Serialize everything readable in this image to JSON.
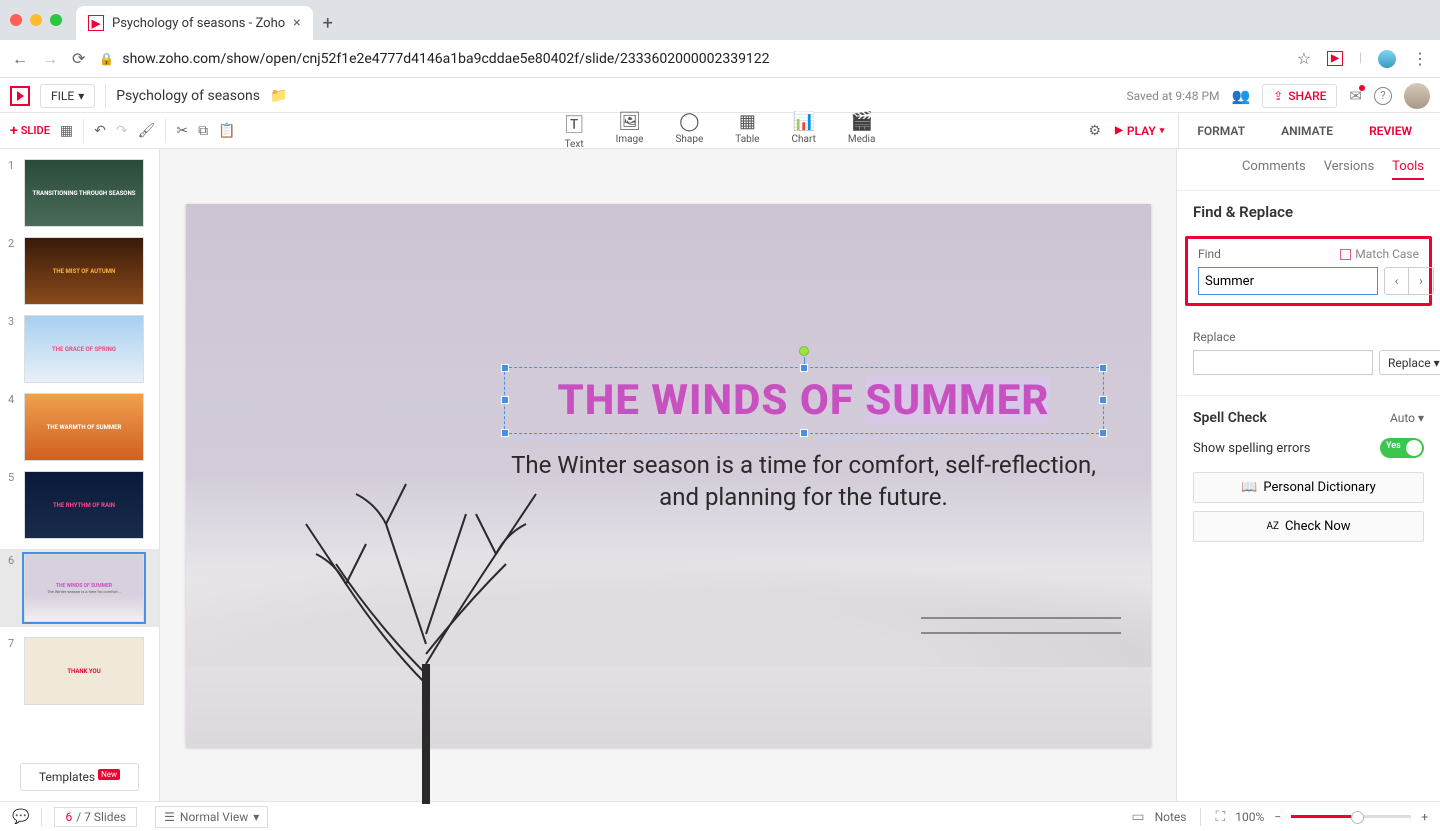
{
  "browser": {
    "tab_title": "Psychology of seasons - Zoho",
    "url": "show.zoho.com/show/open/cnj52f1e2e4777d4146a1ba9cddae5e80402f/slide/2333602000002339122"
  },
  "header": {
    "file_menu": "FILE",
    "doc_title": "Psychology of seasons",
    "saved_text": "Saved at 9:48 PM",
    "share_label": "SHARE"
  },
  "toolbar": {
    "slide_label": "SLIDE",
    "tools": {
      "text": "Text",
      "image": "Image",
      "shape": "Shape",
      "table": "Table",
      "chart": "Chart",
      "media": "Media"
    },
    "play_label": "PLAY",
    "modes": {
      "format": "FORMAT",
      "animate": "ANIMATE",
      "review": "REVIEW"
    }
  },
  "thumbnails": [
    {
      "n": "1",
      "title": "TRANSITIONING THROUGH SEASONS"
    },
    {
      "n": "2",
      "title": "THE MIST OF AUTUMN"
    },
    {
      "n": "3",
      "title": "THE GRACE OF SPRING"
    },
    {
      "n": "4",
      "title": "THE WARMTH OF SUMMER"
    },
    {
      "n": "5",
      "title": "THE RHYTHM OF RAIN"
    },
    {
      "n": "6",
      "title": "THE WINDS OF SUMMER"
    },
    {
      "n": "7",
      "title": "THANK YOU"
    }
  ],
  "templates_label": "Templates",
  "templates_badge": "New",
  "slide": {
    "title_pre": "THE WINDS OF ",
    "title_hl": "SUMMER",
    "body": "The Winter season is a time for comfort, self-reflection, and planning for the future."
  },
  "review_tabs": {
    "comments": "Comments",
    "versions": "Versions",
    "tools": "Tools"
  },
  "find_replace": {
    "heading": "Find & Replace",
    "find_label": "Find",
    "match_case": "Match Case",
    "find_value": "Summer",
    "replace_label": "Replace",
    "replace_value": "",
    "replace_btn": "Replace"
  },
  "spell": {
    "heading": "Spell Check",
    "auto": "Auto",
    "show_errors": "Show spelling errors",
    "toggle_text": "Yes",
    "personal_dict": "Personal Dictionary",
    "check_now": "Check Now"
  },
  "status": {
    "current_slide": "6",
    "total_text": "/ 7 Slides",
    "view_mode": "Normal View",
    "notes": "Notes",
    "zoom": "100%"
  }
}
